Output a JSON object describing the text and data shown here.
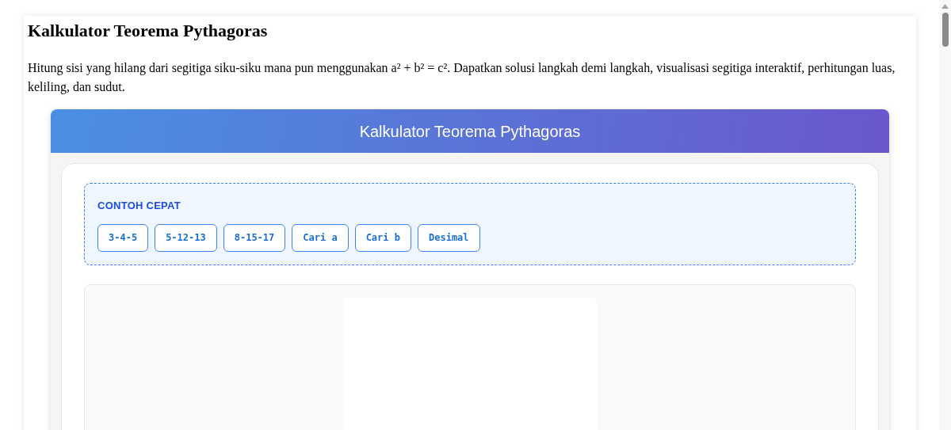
{
  "page": {
    "title": "Kalkulator Teorema Pythagoras",
    "description": "Hitung sisi yang hilang dari segitiga siku-siku mana pun menggunakan a² + b² = c². Dapatkan solusi langkah demi langkah, visualisasi segitiga interaktif, perhitungan luas, keliling, dan sudut."
  },
  "calculator": {
    "header": "Kalkulator Teorema Pythagoras",
    "quick_examples": {
      "label": "CONTOH CEPAT",
      "buttons": [
        "3-4-5",
        "5-12-13",
        "8-15-17",
        "Cari a",
        "Cari b",
        "Desimal"
      ]
    }
  }
}
